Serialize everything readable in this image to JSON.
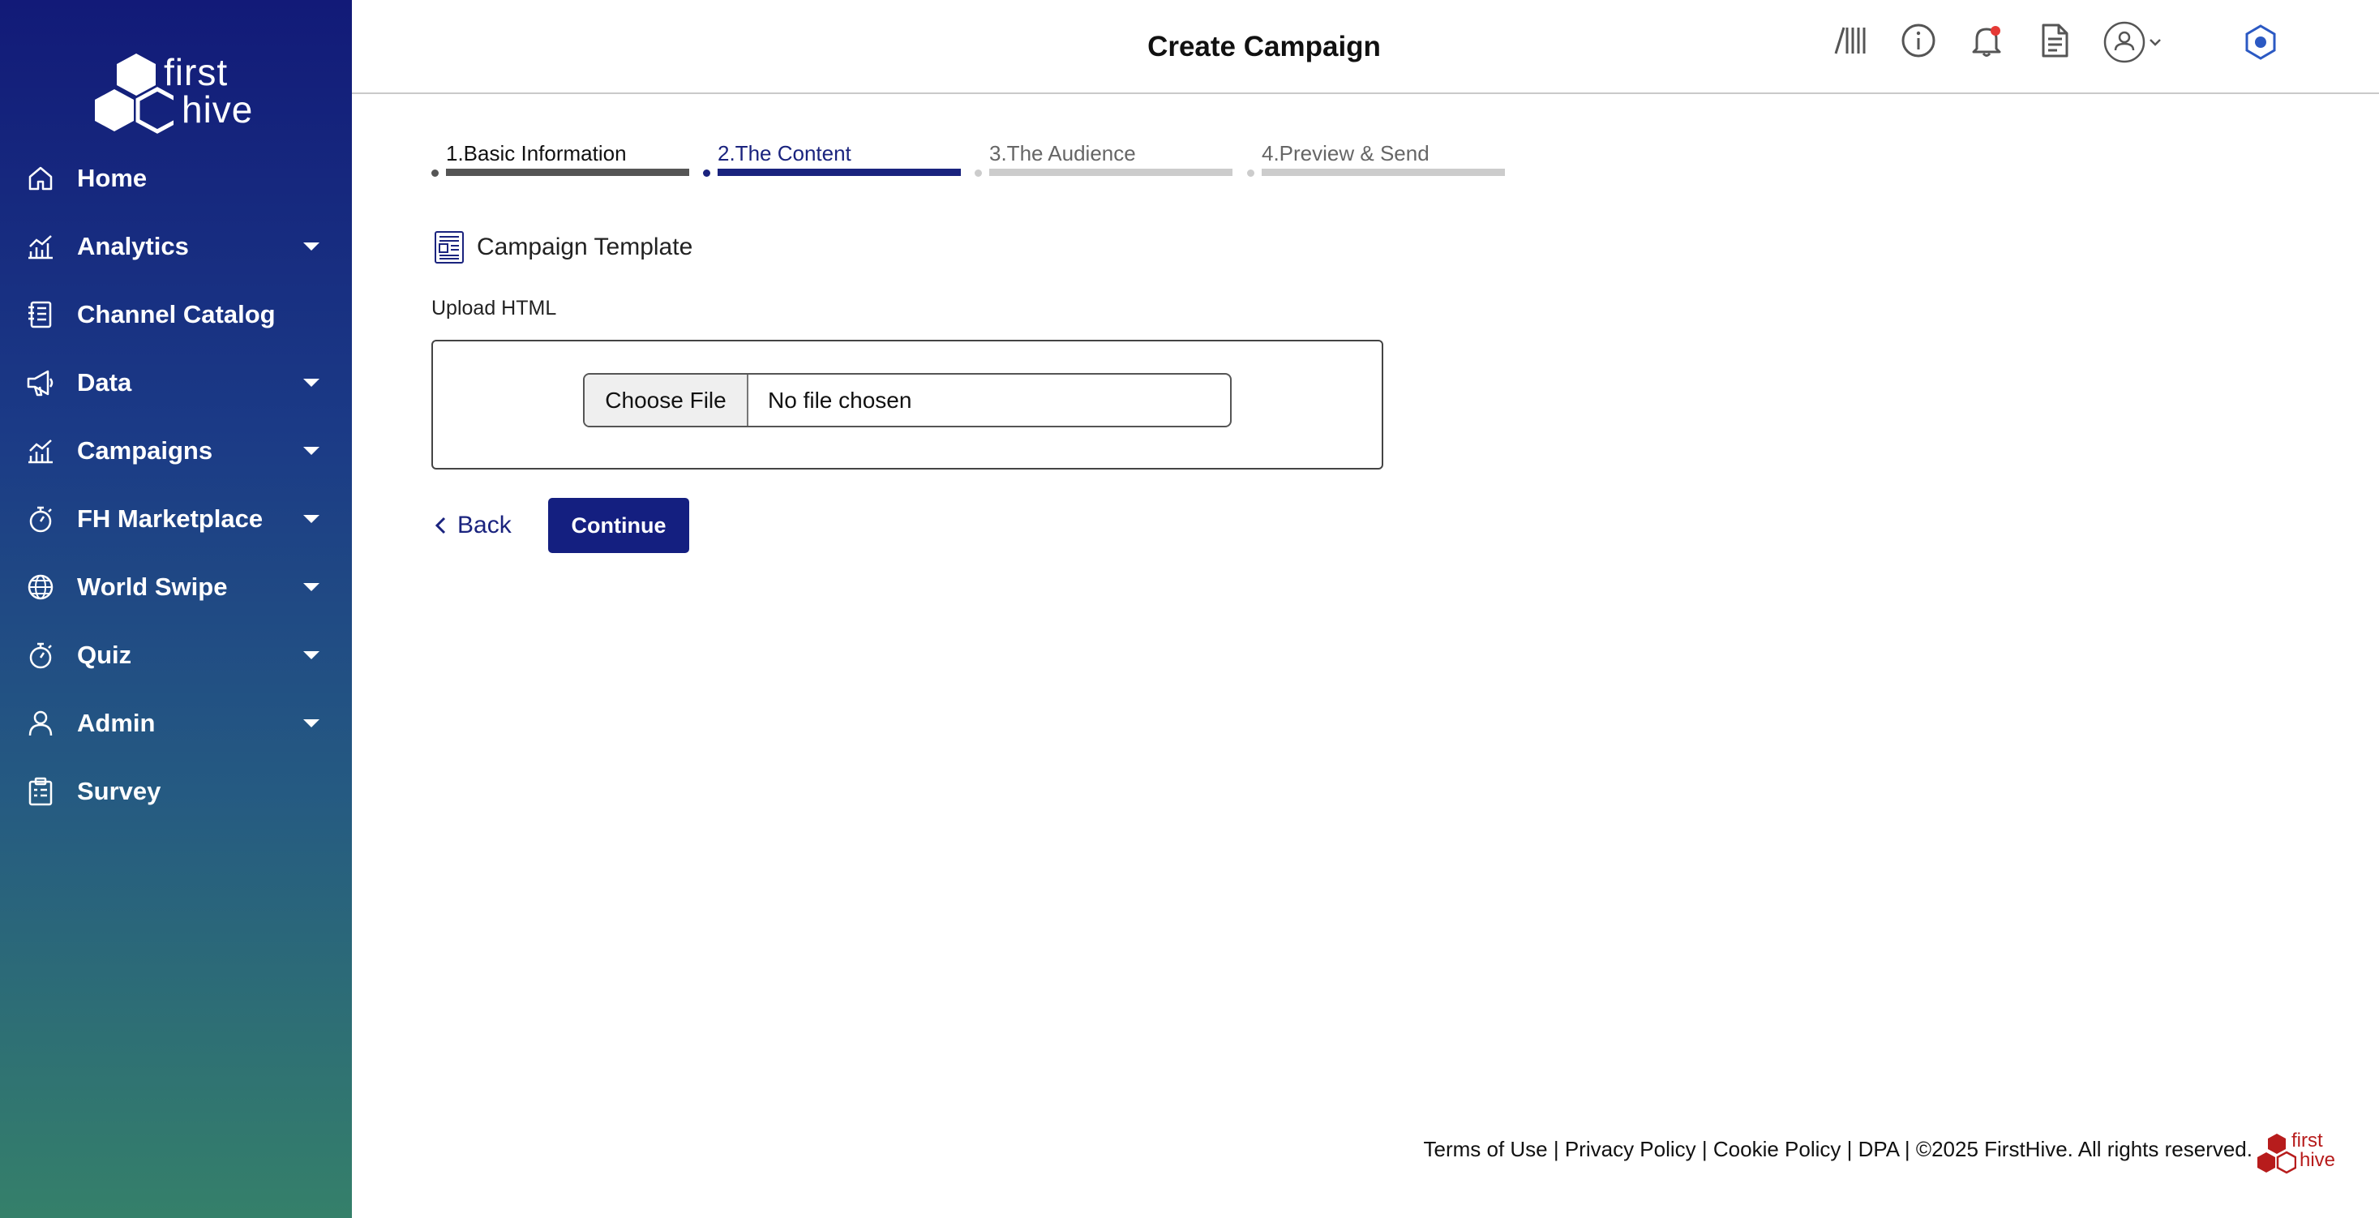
{
  "app": {
    "logo_line1": "first",
    "logo_line2": "hive"
  },
  "sidebar": {
    "items": [
      {
        "label": "Home",
        "icon": "home-icon",
        "has_caret": false
      },
      {
        "label": "Analytics",
        "icon": "analytics-icon",
        "has_caret": true
      },
      {
        "label": "Channel Catalog",
        "icon": "catalog-icon",
        "has_caret": false
      },
      {
        "label": "Data",
        "icon": "megaphone-icon",
        "has_caret": true
      },
      {
        "label": "Campaigns",
        "icon": "campaigns-icon",
        "has_caret": true
      },
      {
        "label": "FH Marketplace",
        "icon": "stopwatch-icon",
        "has_caret": true
      },
      {
        "label": "World Swipe",
        "icon": "globe-icon",
        "has_caret": true
      },
      {
        "label": "Quiz",
        "icon": "stopwatch-icon",
        "has_caret": true
      },
      {
        "label": "Admin",
        "icon": "user-icon",
        "has_caret": true
      },
      {
        "label": "Survey",
        "icon": "clipboard-icon",
        "has_caret": false
      }
    ]
  },
  "header": {
    "title": "Create Campaign",
    "icons": [
      "library-icon",
      "info-icon",
      "bell-icon",
      "document-icon",
      "user-avatar-icon",
      "settings-hex-icon"
    ]
  },
  "stepper": {
    "steps": [
      {
        "label": "1.Basic Information",
        "state": "complete"
      },
      {
        "label": "2.The Content",
        "state": "active"
      },
      {
        "label": "3.The Audience",
        "state": "pending"
      },
      {
        "label": "4.Preview & Send",
        "state": "pending"
      }
    ]
  },
  "content": {
    "section_title": "Campaign Template",
    "upload_label": "Upload HTML",
    "file_button_label": "Choose File",
    "file_status": "No file chosen",
    "back_label": "Back",
    "continue_label": "Continue"
  },
  "footer": {
    "terms": "Terms of Use",
    "privacy": "Privacy Policy",
    "cookie": "Cookie Policy",
    "dpa": "DPA",
    "copyright": "©2025 FirstHive. All rights reserved.",
    "separator": " | ",
    "logo_line1": "first",
    "logo_line2": "hive"
  },
  "colors": {
    "primary": "#141f80",
    "active_step": "#1a237e",
    "complete_step": "#555555",
    "pending_step": "#cccccc",
    "notification_dot": "#e53935",
    "footer_logo": "#b71c1c"
  }
}
